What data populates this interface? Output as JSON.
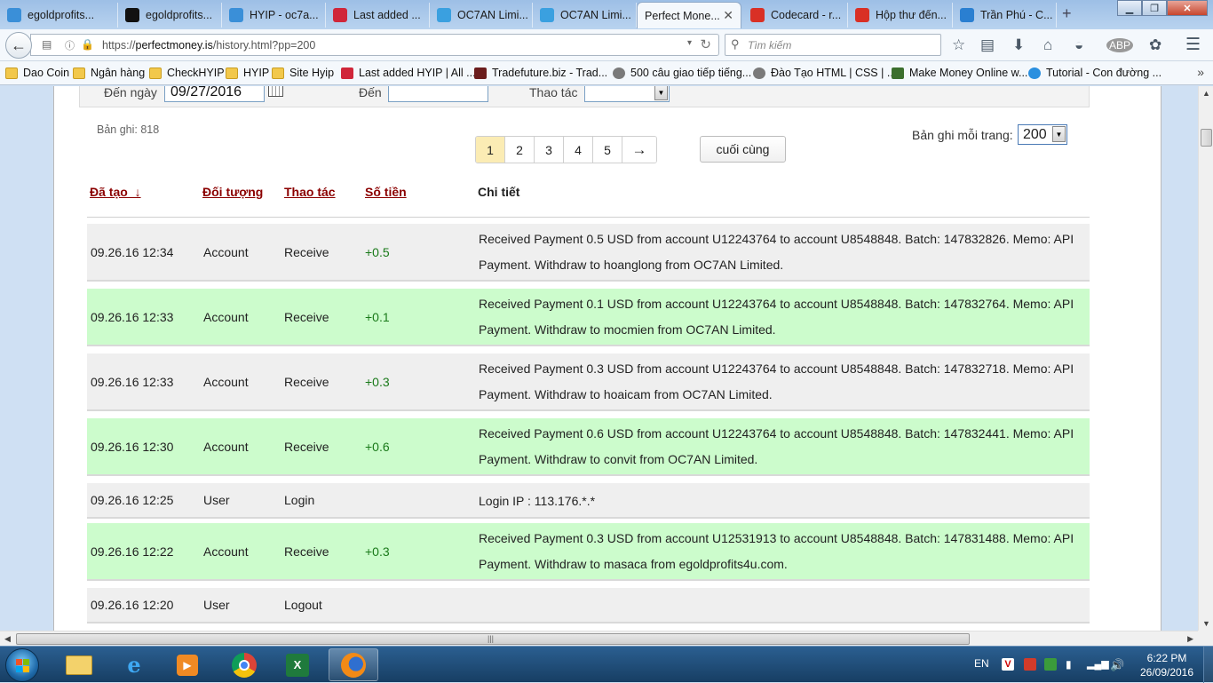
{
  "browser": {
    "tabs": [
      {
        "label": "egoldprofits...",
        "icon": "skype-icon",
        "color": "#3a8fd8"
      },
      {
        "label": "egoldprofits...",
        "icon": "site-icon",
        "color": "#111111"
      },
      {
        "label": "HYIP - oc7a...",
        "icon": "skype-icon",
        "color": "#3a8fd8"
      },
      {
        "label": "Last added ...",
        "icon": "allhyip-icon",
        "color": "#d0263a"
      },
      {
        "label": "OC7AN Limi...",
        "icon": "oc7an-icon",
        "color": "#3aa0e0"
      },
      {
        "label": "OC7AN Limi...",
        "icon": "oc7an-icon",
        "color": "#3aa0e0"
      },
      {
        "label": "Perfect Mone...",
        "icon": "",
        "color": "#ffffff"
      },
      {
        "label": "Codecard - r...",
        "icon": "gmail-icon",
        "color": "#d93025"
      },
      {
        "label": "Hộp thư đến...",
        "icon": "gmail-icon",
        "color": "#d93025"
      },
      {
        "label": "Trần Phú - C...",
        "icon": "c-icon",
        "color": "#2a7fd1"
      }
    ],
    "url_prefix": "https://",
    "url_host": "perfectmoney.is",
    "url_path": "/history.html?pp=200",
    "search_placeholder": "Tìm kiếm",
    "bookmarks": [
      {
        "label": "Dao Coin",
        "type": "folder"
      },
      {
        "label": "Ngân hàng",
        "type": "folder"
      },
      {
        "label": "CheckHYIP",
        "type": "folder"
      },
      {
        "label": "HYIP",
        "type": "folder"
      },
      {
        "label": "Site Hyip",
        "type": "folder"
      },
      {
        "label": "Last added HYIP | All ...",
        "type": "allhyip"
      },
      {
        "label": "Tradefuture.biz - Trad...",
        "type": "site"
      },
      {
        "label": "500 câu giao tiếp tiếng...",
        "type": "globe"
      },
      {
        "label": "Đào Tạo HTML | CSS | ...",
        "type": "globe"
      },
      {
        "label": "Make Money Online w...",
        "type": "site2"
      },
      {
        "label": "Tutorial - Con đường ...",
        "type": "skype"
      }
    ]
  },
  "filters": {
    "to_date_label": "Đến ngày",
    "to_date_value": "09/27/2016",
    "to_label": "Đến",
    "to_value": "",
    "operation_label": "Thao tác",
    "operation_value": ""
  },
  "listing": {
    "record_count": "Bản ghi: 818",
    "pages": [
      "1",
      "2",
      "3",
      "4",
      "5"
    ],
    "current_page": "1",
    "next_label": "→",
    "last_label": "cuối cùng",
    "per_page_label": "Bản ghi mỗi trang:",
    "per_page_value": "200"
  },
  "columns": {
    "created": "Đã tạo_↓",
    "object": "Đối tượng",
    "operation": "Thao tác",
    "amount": "Số tiền",
    "detail": "Chi tiết"
  },
  "rows": [
    {
      "date": "09.26.16 12:34",
      "object": "Account",
      "op": "Receive",
      "amount": "+0.5",
      "detail": "Received Payment 0.5 USD from account U12243764 to account U8548848. Batch: 147832826. Memo: API Payment. Withdraw to hoanglong from OC7AN Limited.",
      "style": "gray"
    },
    {
      "date": "09.26.16 12:33",
      "object": "Account",
      "op": "Receive",
      "amount": "+0.1",
      "detail": "Received Payment 0.1 USD from account U12243764 to account U8548848. Batch: 147832764. Memo: API Payment. Withdraw to mocmien from OC7AN Limited.",
      "style": "green"
    },
    {
      "date": "09.26.16 12:33",
      "object": "Account",
      "op": "Receive",
      "amount": "+0.3",
      "detail": "Received Payment 0.3 USD from account U12243764 to account U8548848. Batch: 147832718. Memo: API Payment. Withdraw to hoaicam from OC7AN Limited.",
      "style": "gray"
    },
    {
      "date": "09.26.16 12:30",
      "object": "Account",
      "op": "Receive",
      "amount": "+0.6",
      "detail": "Received Payment 0.6 USD from account U12243764 to account U8548848. Batch: 147832441. Memo: API Payment. Withdraw to convit from OC7AN Limited.",
      "style": "green"
    },
    {
      "date": "09.26.16 12:25",
      "object": "User",
      "op": "Login",
      "amount": "",
      "detail": "Login IP : 113.176.*.*",
      "style": "gray"
    },
    {
      "date": "09.26.16 12:22",
      "object": "Account",
      "op": "Receive",
      "amount": "+0.3",
      "detail": "Received Payment 0.3 USD from account U12531913 to account U8548848. Batch: 147831488. Memo: API Payment. Withdraw to masaca from egoldprofits4u.com.",
      "style": "green"
    },
    {
      "date": "09.26.16 12:20",
      "object": "User",
      "op": "Logout",
      "amount": "",
      "detail": "",
      "style": "gray"
    }
  ],
  "taskbar": {
    "language": "EN",
    "time": "6:22 PM",
    "date": "26/09/2016"
  }
}
